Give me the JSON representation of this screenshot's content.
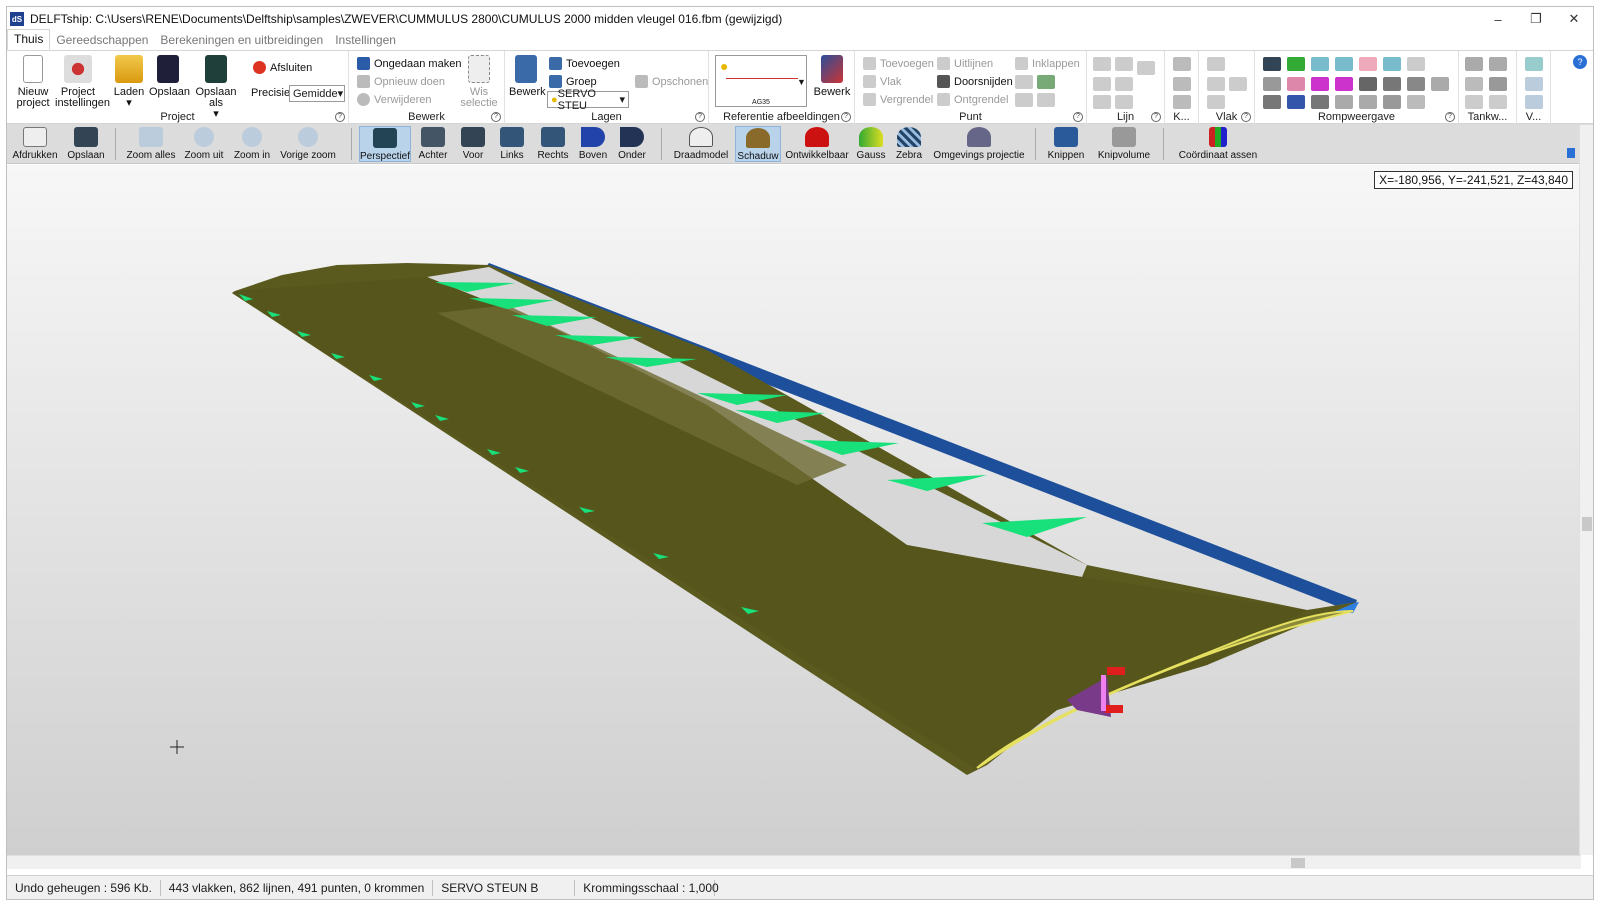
{
  "window": {
    "title": "DELFTship: C:\\Users\\RENE\\Documents\\Delftship\\samples\\ZWEVER\\CUMMULUS 2800\\CUMULUS 2000 midden vleugel 016.fbm (gewijzigd)",
    "app_icon_text": "dS",
    "controls": {
      "minimize": "–",
      "restore": "❐",
      "close": "✕"
    }
  },
  "tabs": [
    {
      "label": "Thuis",
      "active": true
    },
    {
      "label": "Gereedschappen",
      "active": false
    },
    {
      "label": "Berekeningen en uitbreidingen",
      "active": false
    },
    {
      "label": "Instellingen",
      "active": false
    }
  ],
  "ribbon": {
    "project": {
      "label": "Project",
      "new": "Nieuw project",
      "settings": "Project instellingen",
      "load": "Laden",
      "save": "Opslaan",
      "save_as": "Opslaan als",
      "close": "Afsluiten",
      "precision_label": "Precisie",
      "precision_value": "Gemidde"
    },
    "edit": {
      "label": "Bewerk",
      "undo": "Ongedaan maken",
      "redo": "Opnieuw doen",
      "delete": "Verwijderen",
      "clear_selection": "Wis selectie"
    },
    "layers": {
      "label": "Lagen",
      "edit": "Bewerk",
      "add": "Toevoegen",
      "group": "Groep",
      "clean": "Opschonen",
      "active_layer": "SERVO STEU"
    },
    "reference": {
      "label": "Referentie afbeeldingen",
      "preview_caption": "AG35",
      "edit": "Bewerk"
    },
    "point": {
      "label": "Punt",
      "add": "Toevoegen",
      "plane": "Vlak",
      "lock": "Vergrendel",
      "align": "Uitlijnen",
      "intersect": "Doorsnijden",
      "unlock": "Ontgrendel",
      "collapse": "Inklappen"
    },
    "line": {
      "label": "Lijn"
    },
    "curve": {
      "label": "K..."
    },
    "face": {
      "label": "Vlak"
    },
    "hull_view": {
      "label": "Rompweergave"
    },
    "tanks": {
      "label": "Tankw..."
    },
    "view": {
      "label": "V..."
    }
  },
  "toolbar": {
    "print": "Afdrukken",
    "save": "Opslaan",
    "zoom_all": "Zoom alles",
    "zoom_out": "Zoom uit",
    "zoom_in": "Zoom in",
    "prev_zoom": "Vorige zoom",
    "perspective": "Perspectief",
    "back": "Achter",
    "front": "Voor",
    "left": "Links",
    "right": "Rechts",
    "top": "Boven",
    "bottom": "Onder",
    "wireframe": "Draadmodel",
    "shade": "Schaduw",
    "developable": "Ontwikkelbaar",
    "gauss": "Gauss",
    "zebra": "Zebra",
    "env_projection": "Omgevings projectie",
    "clip": "Knippen",
    "clip_volume": "Knipvolume",
    "coord_axes": "Coördinaat assen"
  },
  "viewport": {
    "coordinates": "X=-180,956, Y=-241,521, Z=43,840",
    "colors": {
      "skin": "#5a5a1e",
      "rib": "#18e07a",
      "spar": "#1d4f9a",
      "servo": "#e01e1e",
      "cavity": "#7a3a8a"
    }
  },
  "status": {
    "undo_memory": "Undo geheugen : 596 Kb.",
    "counts": "443 vlakken, 862 lijnen, 491 punten, 0 krommen",
    "active_layer": "SERVO STEUN B",
    "curvature_scale": "Krommingsschaal : 1,000"
  }
}
